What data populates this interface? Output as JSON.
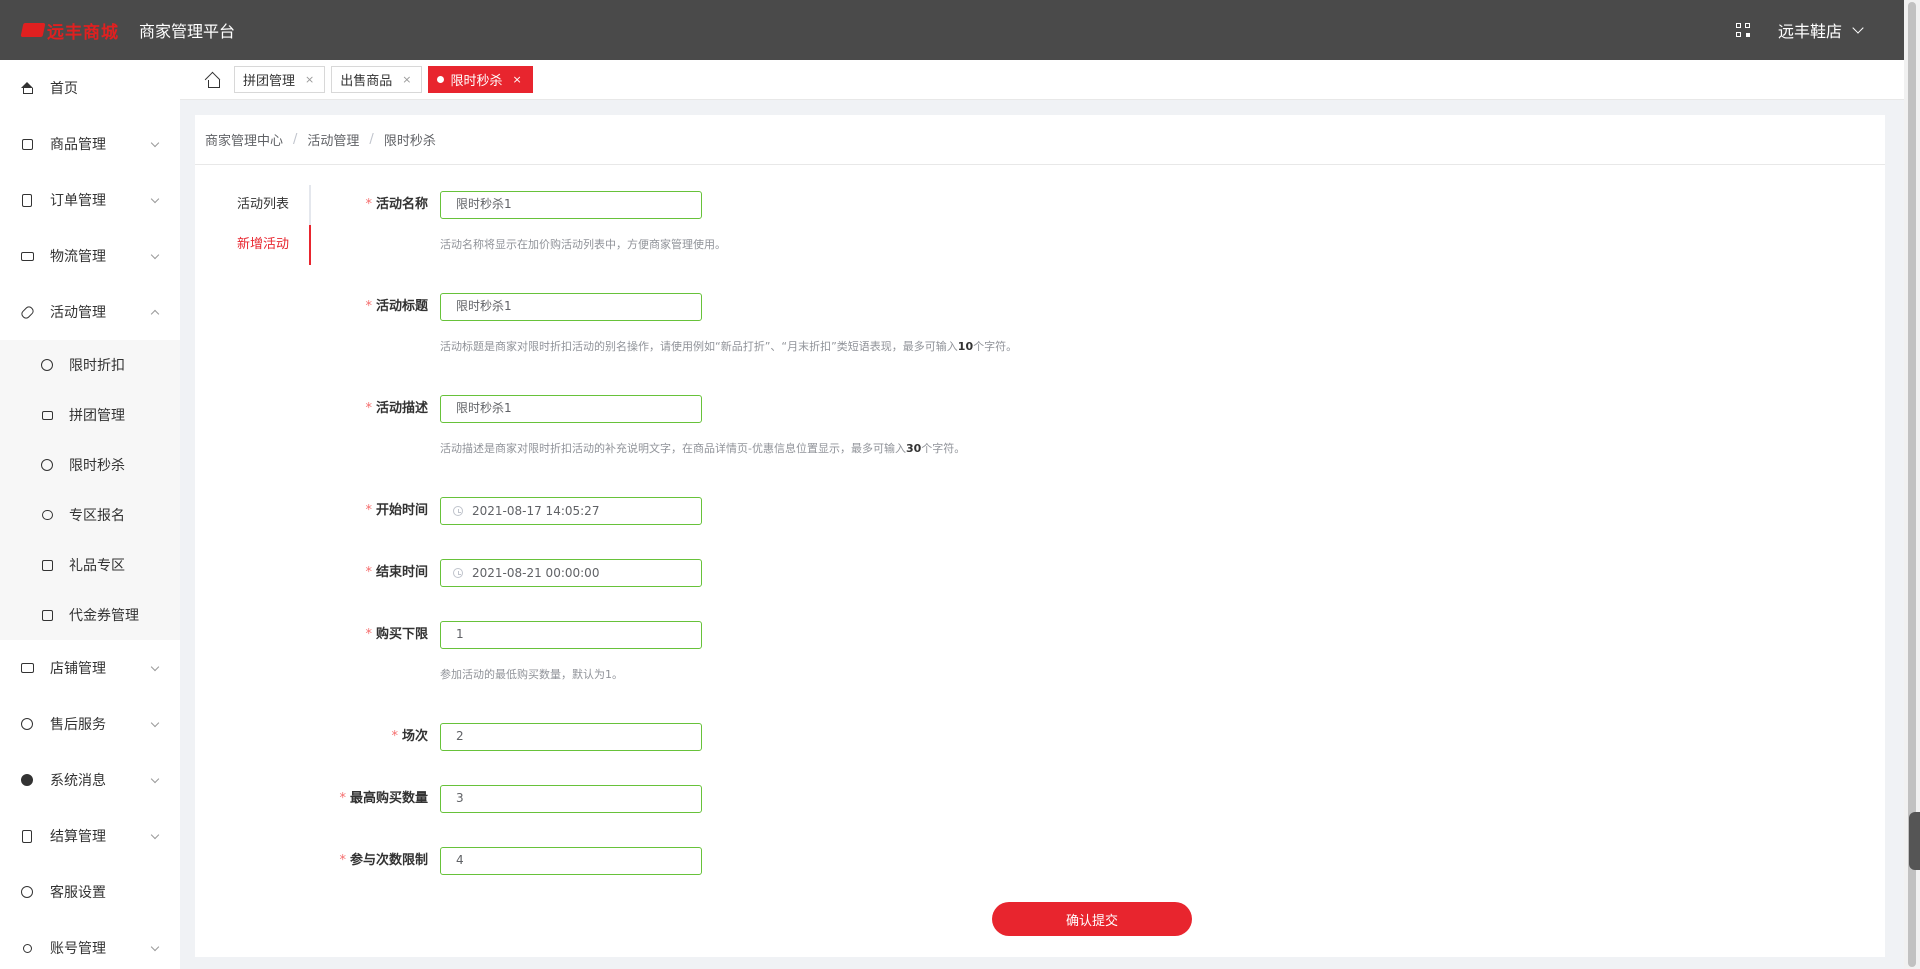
{
  "header": {
    "logo_text": "远丰商城",
    "platform_title": "商家管理平台",
    "shop_name": "远丰鞋店"
  },
  "sidebar": {
    "items": [
      {
        "label": "首页",
        "icon": "home-icon"
      },
      {
        "label": "商品管理",
        "icon": "goods-icon"
      },
      {
        "label": "订单管理",
        "icon": "order-icon"
      },
      {
        "label": "物流管理",
        "icon": "logistics-icon"
      },
      {
        "label": "活动管理",
        "icon": "activity-icon"
      },
      {
        "label": "店铺管理",
        "icon": "store-icon"
      },
      {
        "label": "售后服务",
        "icon": "aftersale-icon"
      },
      {
        "label": "系统消息",
        "icon": "message-icon"
      },
      {
        "label": "结算管理",
        "icon": "settlement-icon"
      },
      {
        "label": "客服设置",
        "icon": "service-icon"
      },
      {
        "label": "账号管理",
        "icon": "account-icon"
      }
    ],
    "sub_items": [
      {
        "label": "限时折扣",
        "icon": "discount-icon"
      },
      {
        "label": "拼团管理",
        "icon": "group-icon"
      },
      {
        "label": "限时秒杀",
        "icon": "alarm-icon"
      },
      {
        "label": "专区报名",
        "icon": "zone-icon"
      },
      {
        "label": "礼品专区",
        "icon": "gift-icon"
      },
      {
        "label": "代金券管理",
        "icon": "coupon-icon"
      }
    ]
  },
  "tabs": [
    {
      "label": "拼团管理",
      "close": "×"
    },
    {
      "label": "出售商品",
      "close": "×"
    },
    {
      "label": "限时秒杀",
      "close": "×",
      "active": true
    }
  ],
  "breadcrumb": [
    "商家管理中心",
    "活动管理",
    "限时秒杀"
  ],
  "breadcrumb_sep": "/",
  "side_tabs": [
    "活动列表",
    "新增活动"
  ],
  "form": {
    "required_mark": "*",
    "fields": [
      {
        "label": "活动名称",
        "value": "限时秒杀1",
        "hint": "活动名称将显示在加价购活动列表中，方便商家管理使用。"
      },
      {
        "label": "活动标题",
        "value": "限时秒杀1",
        "hint_pre": "活动标题是商家对限时折扣活动的别名操作，请使用例如“新品打折”、“月末折扣”类短语表现，最多可输入",
        "hint_num": "10",
        "hint_post": "个字符。"
      },
      {
        "label": "活动描述",
        "value": "限时秒杀1",
        "hint_pre": "活动描述是商家对限时折扣活动的补充说明文字，在商品详情页-优惠信息位置显示，最多可输入",
        "hint_num": "30",
        "hint_post": "个字符。"
      },
      {
        "label": "开始时间",
        "value": "2021-08-17 14:05:27"
      },
      {
        "label": "结束时间",
        "value": "2021-08-21 00:00:00"
      },
      {
        "label": "购买下限",
        "value": "1",
        "hint": "参加活动的最低购买数量，默认为1。"
      },
      {
        "label": "场次",
        "value": "2"
      },
      {
        "label": "最高购买数量",
        "value": "3"
      },
      {
        "label": "参与次数限制",
        "value": "4"
      }
    ],
    "submit_label": "确认提交"
  },
  "colors": {
    "brand_red": "#e8252e",
    "input_border": "#67c23a",
    "header_bg": "#4a4a4a"
  }
}
